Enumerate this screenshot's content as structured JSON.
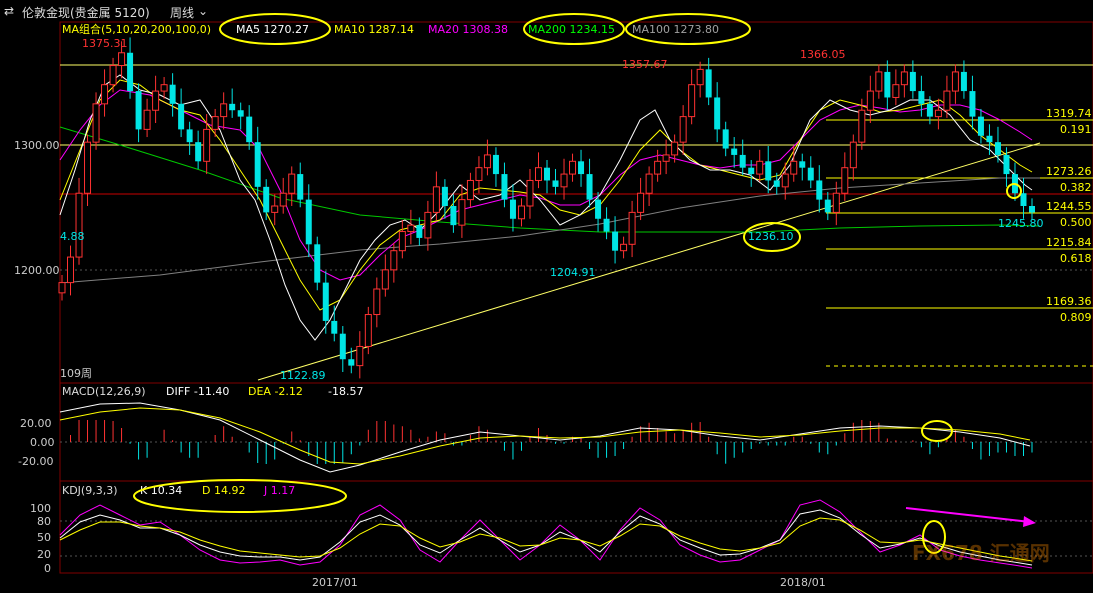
{
  "toolbar": {
    "instrument": "伦敦金现(贵金属 5120)",
    "period": "周线"
  },
  "legend_ma": {
    "title": "MA组合(5,10,20,200,100,0)",
    "ma5": "MA5 1270.27",
    "ma10": "MA10 1287.14",
    "ma20": "MA20 1308.38",
    "ma200": "MA200 1234.15",
    "ma100": "MA100 1273.80"
  },
  "legend_macd": {
    "title": "MACD(12,26,9)",
    "diff": "DIFF -11.40",
    "dea": "DEA -2.12",
    "macd": "-18.57"
  },
  "legend_kdj": {
    "title": "KDJ(9,3,3)",
    "k": "K 10.34",
    "d": "D 14.92",
    "j": "J 1.17"
  },
  "price_axis": [
    "1300.00",
    "1200.00"
  ],
  "macd_axis": [
    "20.00",
    "0.00",
    "-20.00"
  ],
  "kdj_axis": [
    "100",
    "80",
    "50",
    "20",
    "0"
  ],
  "x_axis": [
    "2017/01",
    "2018/01"
  ],
  "annotations": {
    "high_left": "1375.31",
    "left_edge": "4.88",
    "low": "1122.89",
    "peak_mid": "1357.67",
    "low_mid": "1204.91",
    "high_right": "1366.05",
    "low_right": "1236.10",
    "last": "1245.80",
    "bars_count": "109周"
  },
  "fib_levels": [
    {
      "price": "1319.74",
      "ratio": "0.191"
    },
    {
      "price": "1273.26",
      "ratio": "0.382"
    },
    {
      "price": "1244.55",
      "ratio": "0.500"
    },
    {
      "price": "1215.84",
      "ratio": "0.618"
    },
    {
      "price": "1169.36",
      "ratio": "0.809"
    }
  ],
  "watermark": "FX678 汇通网",
  "colors": {
    "up": "#ff3232",
    "down": "#00e5e5",
    "ma5": "#ffffff",
    "ma10": "#ffff00",
    "ma20": "#ff00ff",
    "ma200": "#00c800",
    "ma100": "#808080",
    "highlight": "#ffff00",
    "fib": "#ffff00",
    "red_line": "#c80000"
  },
  "chart_data": {
    "type": "candlestick",
    "title": "伦敦金现 周线",
    "ylim": [
      1120,
      1380
    ],
    "closes": [
      1190,
      1210,
      1260,
      1300,
      1330,
      1345,
      1360,
      1370,
      1340,
      1310,
      1325,
      1340,
      1345,
      1330,
      1310,
      1300,
      1285,
      1310,
      1320,
      1330,
      1325,
      1320,
      1300,
      1265,
      1245,
      1250,
      1260,
      1275,
      1255,
      1220,
      1190,
      1160,
      1150,
      1130,
      1125,
      1140,
      1165,
      1185,
      1200,
      1215,
      1230,
      1235,
      1225,
      1245,
      1265,
      1250,
      1235,
      1255,
      1270,
      1280,
      1290,
      1275,
      1255,
      1240,
      1250,
      1270,
      1280,
      1270,
      1265,
      1275,
      1285,
      1275,
      1255,
      1240,
      1230,
      1215,
      1220,
      1245,
      1260,
      1275,
      1285,
      1290,
      1300,
      1320,
      1345,
      1357,
      1335,
      1310,
      1295,
      1290,
      1280,
      1275,
      1285,
      1270,
      1265,
      1275,
      1285,
      1280,
      1270,
      1255,
      1245,
      1260,
      1280,
      1300,
      1325,
      1340,
      1355,
      1335,
      1345,
      1355,
      1340,
      1330,
      1320,
      1325,
      1340,
      1355,
      1340,
      1320,
      1305,
      1300,
      1290,
      1275,
      1260,
      1250,
      1245
    ]
  }
}
